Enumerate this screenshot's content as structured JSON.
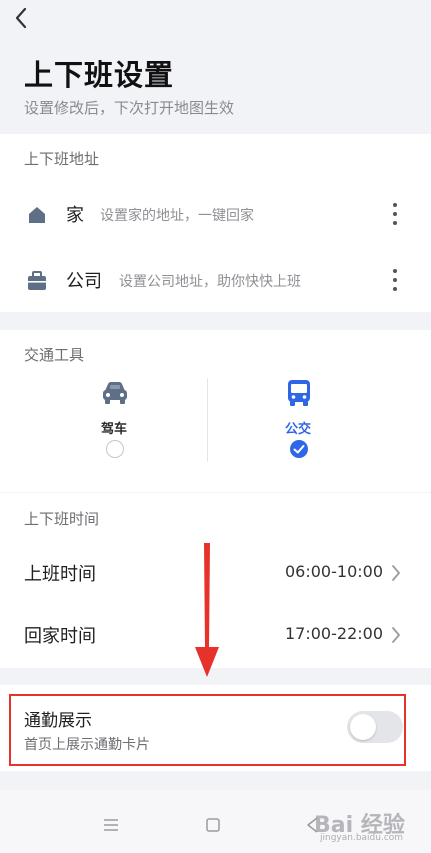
{
  "header": {
    "title": "上下班设置",
    "subtitle": "设置修改后，下次打开地图生效"
  },
  "address_section": {
    "title": "上下班地址",
    "home": {
      "name": "家",
      "hint": "设置家的地址，一键回家",
      "icon": "home-icon"
    },
    "work": {
      "name": "公司",
      "hint": "设置公司地址，助你快快上班",
      "icon": "briefcase-icon"
    }
  },
  "transport_section": {
    "title": "交通工具",
    "modes": [
      {
        "label": "驾车",
        "icon": "car-icon",
        "selected": false
      },
      {
        "label": "公交",
        "icon": "bus-icon",
        "selected": true
      }
    ]
  },
  "time_section": {
    "title": "上下班时间",
    "rows": [
      {
        "label": "上班时间",
        "value": "06:00-10:00"
      },
      {
        "label": "回家时间",
        "value": "17:00-22:00"
      }
    ]
  },
  "commute_display": {
    "title": "通勤展示",
    "subtitle": "首页上展示通勤卡片",
    "enabled": false
  },
  "watermark": {
    "text": "Bai 经验",
    "url": "jingyan.baidu.com"
  },
  "colors": {
    "accent": "#2f66e8",
    "highlight": "#e7312b",
    "background": "#f2f3f7",
    "icon_gray": "#5f6f86"
  }
}
